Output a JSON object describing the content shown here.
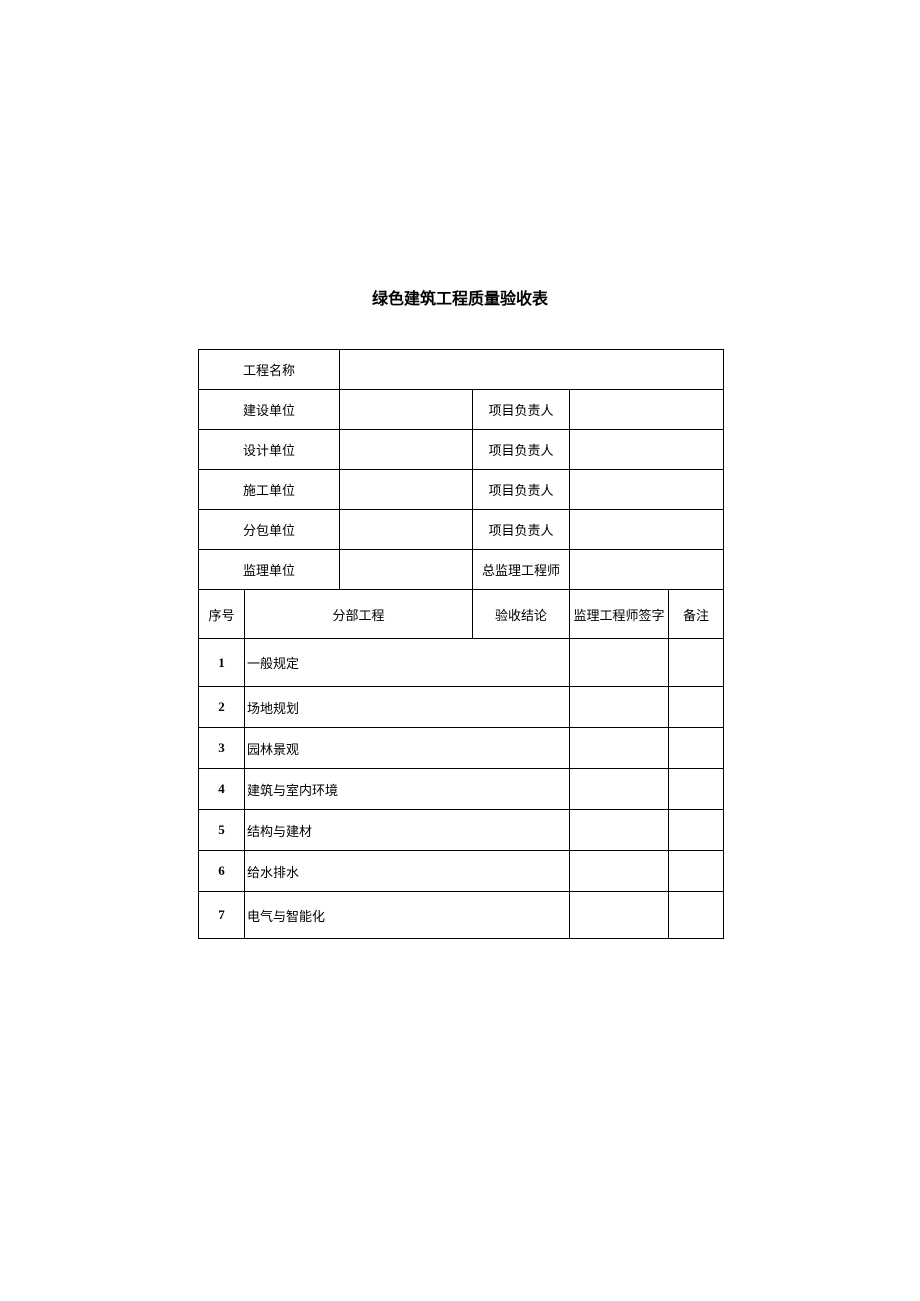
{
  "title": "绿色建筑工程质量验收表",
  "header": {
    "project_name_label": "工程名称",
    "construction_unit_label": "建设单位",
    "design_unit_label": "设计单位",
    "builder_unit_label": "施工单位",
    "subcontract_unit_label": "分包单位",
    "supervision_unit_label": "监理单位",
    "project_leader_label": "项目负责人",
    "chief_engineer_label": "总监理工程师"
  },
  "columns": {
    "seq": "序号",
    "division": "分部工程",
    "conclusion": "验收结论",
    "supervisor_sign": "监理工程师签字",
    "notes": "备注"
  },
  "rows": [
    {
      "seq": "1",
      "name": "一般规定"
    },
    {
      "seq": "2",
      "name": "场地规划"
    },
    {
      "seq": "3",
      "name": "园林景观"
    },
    {
      "seq": "4",
      "name": "建筑与室内环境"
    },
    {
      "seq": "5",
      "name": "结构与建材"
    },
    {
      "seq": "6",
      "name": "给水排水"
    },
    {
      "seq": "7",
      "name": "电气与智能化"
    }
  ]
}
